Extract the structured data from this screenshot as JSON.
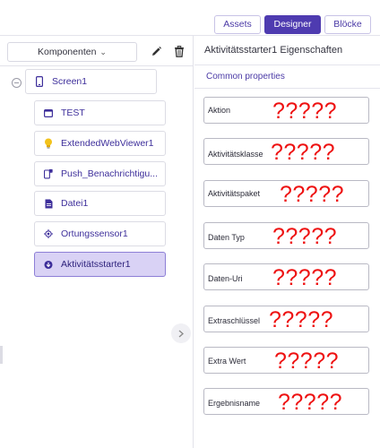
{
  "toolbar": {
    "assets_label": "Assets",
    "designer_label": "Designer",
    "bloecke_label": "Blöcke"
  },
  "components_panel": {
    "dropdown_label": "Komponenten",
    "tree": {
      "screen": {
        "label": "Screen1",
        "icon": "phone-icon"
      },
      "children": [
        {
          "label": "TEST",
          "icon": "window-icon"
        },
        {
          "label": "ExtendedWebViewer1",
          "icon": "lightbulb-icon"
        },
        {
          "label": "Push_Benachrichtigu...",
          "icon": "notification-icon"
        },
        {
          "label": "Datei1",
          "icon": "file-icon"
        },
        {
          "label": "Ortungssensor1",
          "icon": "location-target-icon"
        },
        {
          "label": "Aktivitätsstarter1",
          "icon": "activity-icon",
          "selected": true
        }
      ]
    }
  },
  "properties_panel": {
    "title": "Aktivitätsstarter1 Eigenschaften",
    "section": "Common properties",
    "properties": [
      {
        "label": "Aktion",
        "value": "?????"
      },
      {
        "label": "Aktivitätsklasse",
        "value": "?????"
      },
      {
        "label": "Aktivitätspaket",
        "value": "?????"
      },
      {
        "label": "Daten Typ",
        "value": "?????"
      },
      {
        "label": "Daten-Uri",
        "value": "?????"
      },
      {
        "label": "Extraschlüssel",
        "value": "?????"
      },
      {
        "label": "Extra Wert",
        "value": "?????"
      },
      {
        "label": "Ergebnisname",
        "value": "?????"
      }
    ]
  },
  "colors": {
    "accent": "#4e3bb0",
    "selected_bg": "#d9d2f5",
    "annotation": "#ee1111"
  }
}
